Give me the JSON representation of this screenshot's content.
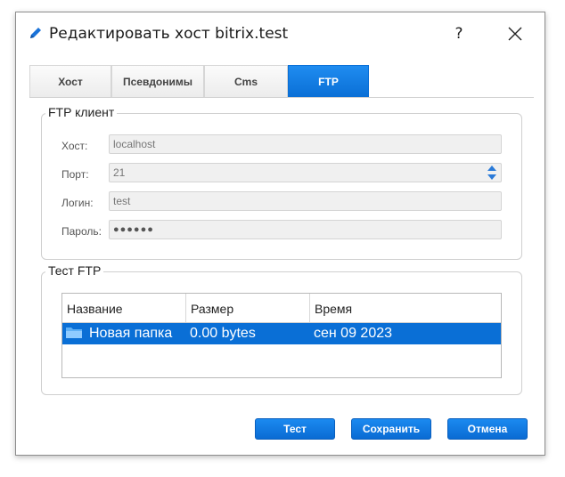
{
  "window": {
    "title": "Редактировать хост bitrix.test",
    "help_label": "?"
  },
  "tabs": [
    {
      "label": "Хост",
      "active": false
    },
    {
      "label": "Псевдонимы",
      "active": false
    },
    {
      "label": "Cms",
      "active": false
    },
    {
      "label": "FTP",
      "active": true
    }
  ],
  "ftp_client": {
    "legend": "FTP клиент",
    "host_label": "Хост:",
    "host_value": "localhost",
    "port_label": "Порт:",
    "port_value": "21",
    "login_label": "Логин:",
    "login_value": "test",
    "password_label": "Пароль:",
    "password_value": "●●●●●●"
  },
  "ftp_test": {
    "legend": "Тест FTP",
    "columns": [
      "Название",
      "Размер",
      "Время"
    ],
    "rows": [
      {
        "name": "Новая папка",
        "size": "0.00 bytes",
        "time": "сен 09 2023",
        "icon": "folder-icon",
        "selected": true
      }
    ]
  },
  "buttons": {
    "test": "Тест",
    "save": "Сохранить",
    "cancel": "Отмена"
  },
  "colors": {
    "accent": "#0a6fd6",
    "selected_row": "#0a6fd6",
    "field_bg": "#f0f0f0"
  }
}
